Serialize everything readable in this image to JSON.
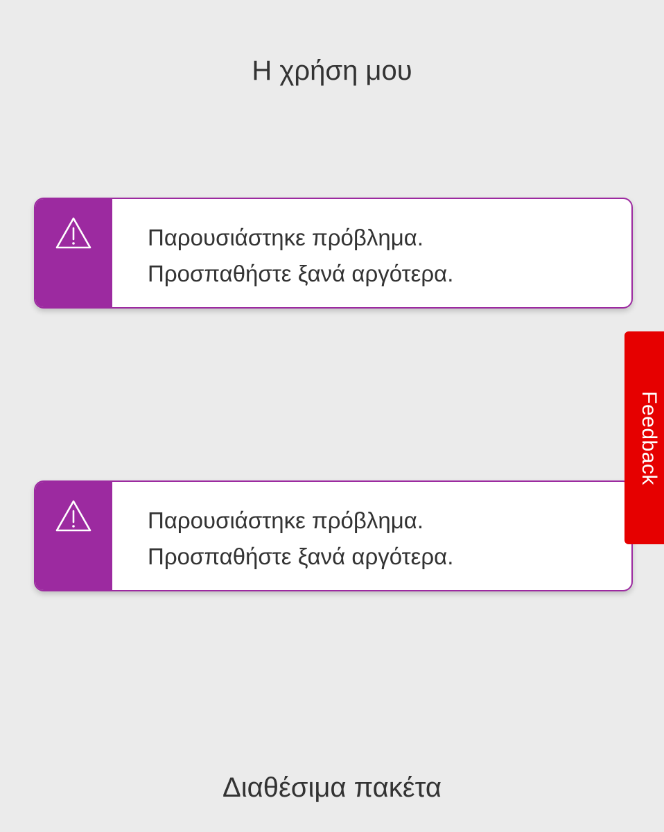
{
  "usage_section": {
    "title": "Η χρήση μου"
  },
  "alerts": [
    {
      "icon": "warning-icon",
      "line1": "Παρουσιάστηκε πρόβλημα.",
      "line2": "Προσπαθήστε ξανά αργότερα."
    },
    {
      "icon": "warning-icon",
      "line1": "Παρουσιάστηκε πρόβλημα.",
      "line2": "Προσπαθήστε ξανά αργότερα."
    }
  ],
  "packages_section": {
    "title": "Διαθέσιμα πακέτα"
  },
  "feedback": {
    "label": "Feedback"
  },
  "colors": {
    "background": "#ebebeb",
    "alert_accent": "#9c2aa0",
    "feedback": "#e60000",
    "text": "#333333"
  }
}
